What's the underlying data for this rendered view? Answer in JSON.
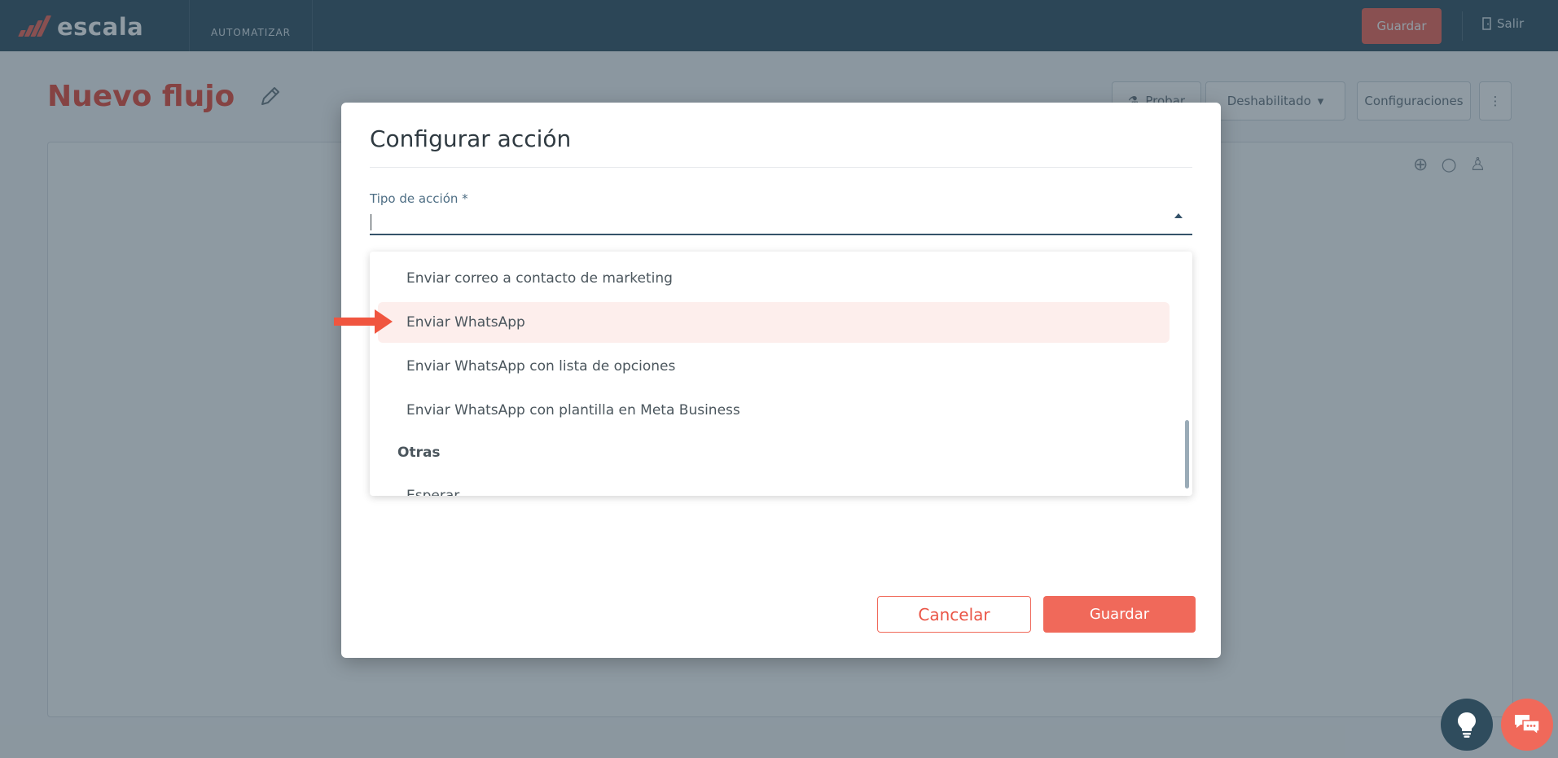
{
  "topbar": {
    "logo_text": "escala",
    "nav_item": "AUTOMATIZAR",
    "save_label": "Guardar",
    "exit_label": "Salir"
  },
  "page": {
    "title": "Nuevo flujo",
    "toolbar": {
      "test_label": "Probar",
      "status_label": "Deshabilitado",
      "settings_label": "Configuraciones"
    }
  },
  "modal": {
    "title": "Configurar acción",
    "field_label": "Tipo de acción *",
    "field_value": "",
    "options": [
      "Enviar correo a contacto de marketing",
      "Enviar WhatsApp",
      "Enviar WhatsApp con lista de opciones",
      "Enviar WhatsApp con plantilla en Meta Business"
    ],
    "selected_option": "Enviar WhatsApp",
    "group_label": "Otras",
    "next_option_partial": "Esperar",
    "cancel_label": "Cancelar",
    "save_label": "Guardar"
  },
  "icons": {
    "pencil": "pencil-icon",
    "lightbulb": "lightbulb-icon",
    "chat": "chat-icon",
    "arrow": "arrow-right-icon"
  },
  "colors": {
    "brand_coral": "#f0695a",
    "topbar": "#375466",
    "title_red": "#e94f3f",
    "selected_bg": "#fdeeec"
  }
}
